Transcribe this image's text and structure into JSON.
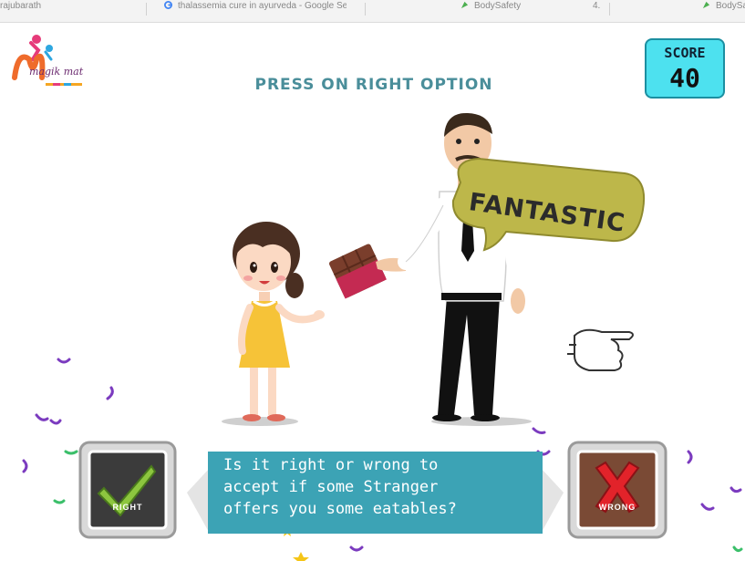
{
  "browser_tabs": [
    {
      "label": "rajubarath",
      "icon": "none"
    },
    {
      "label": "thalassemia cure in ayurveda - Google Search",
      "icon": "google-icon"
    },
    {
      "label": "BodySafety",
      "icon": "leaf-icon"
    },
    {
      "label": "4.",
      "icon": "none"
    },
    {
      "label": "BodySafe",
      "icon": "leaf-icon"
    }
  ],
  "logo": {
    "text": "magik mat"
  },
  "instruction": "PRESS ON RIGHT OPTION",
  "score": {
    "label": "SCORE",
    "value": "40"
  },
  "feedback": "FANTASTIC",
  "question": {
    "lines": [
      "Is it right or wrong to",
      "accept if some Stranger",
      "offers you some eatables?"
    ]
  },
  "options": {
    "right_label": "RIGHT",
    "wrong_label": "WRONG"
  },
  "colors": {
    "instruction": "#4a8e9a",
    "score_bg": "#4de1ef",
    "question_banner": "#3ca3b5",
    "fantastic_bubble": "#bdb74a",
    "girl_dress": "#f6c338",
    "man_shirt": "#ffffff"
  }
}
